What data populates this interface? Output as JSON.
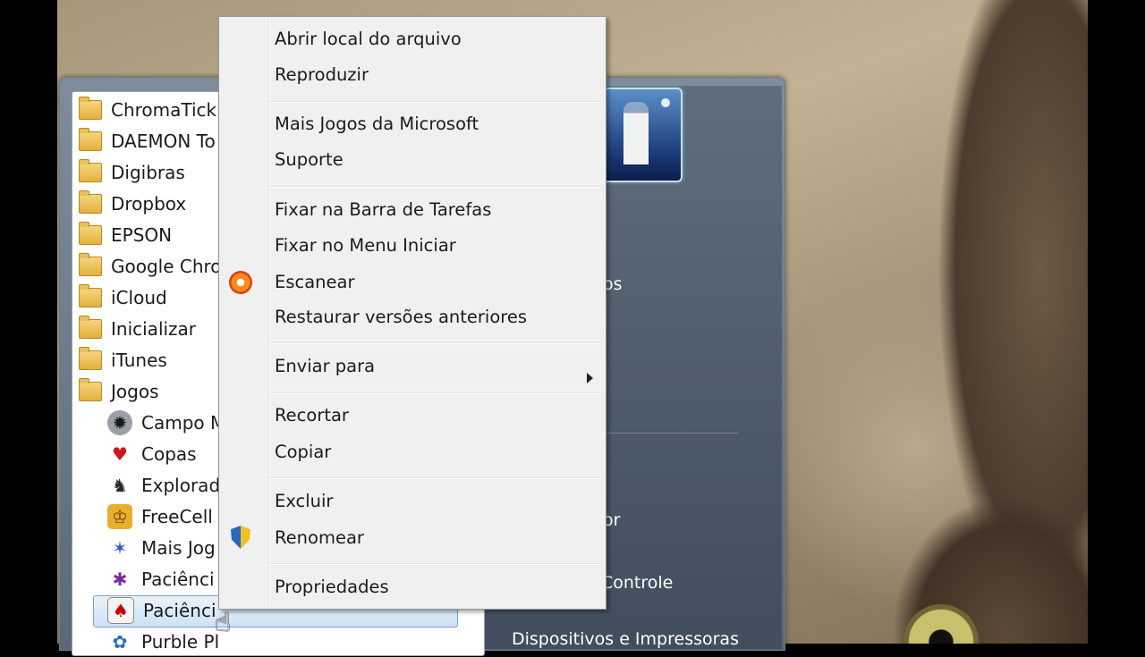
{
  "context_menu": {
    "items": [
      {
        "label": "Abrir local do arquivo"
      },
      {
        "label": "Reproduzir"
      },
      {
        "label": "Mais Jogos da Microsoft"
      },
      {
        "label": "Suporte"
      },
      {
        "label": "Fixar na Barra de Tarefas"
      },
      {
        "label": "Fixar no Menu Iniciar"
      },
      {
        "label": "Escanear",
        "icon": "scan-icon"
      },
      {
        "label": "Restaurar versões anteriores"
      },
      {
        "label": "Enviar para",
        "icon": "submenu-arrow-icon"
      },
      {
        "label": "Recortar"
      },
      {
        "label": "Copiar"
      },
      {
        "label": "Excluir"
      },
      {
        "label": "Renomear",
        "icon": "shield-icon"
      },
      {
        "label": "Propriedades"
      }
    ]
  },
  "programs": {
    "folders": [
      {
        "label": "ChromaTick"
      },
      {
        "label": "DAEMON To"
      },
      {
        "label": "Digibras"
      },
      {
        "label": "Dropbox"
      },
      {
        "label": "EPSON"
      },
      {
        "label": "Google Chro"
      },
      {
        "label": "iCloud"
      },
      {
        "label": "Inicializar"
      },
      {
        "label": "iTunes"
      },
      {
        "label": "Jogos"
      }
    ],
    "games": [
      {
        "label": "Campo M",
        "icon": "minesweeper-icon"
      },
      {
        "label": "Copas",
        "icon": "hearts-icon"
      },
      {
        "label": "Explorad",
        "icon": "chess-icon"
      },
      {
        "label": "FreeCell",
        "icon": "freecell-icon"
      },
      {
        "label": "Mais Jog",
        "icon": "more-games-icon"
      },
      {
        "label": "Paciênci",
        "icon": "spider-solitaire-icon"
      },
      {
        "label": "Paciênci",
        "icon": "solitaire-icon",
        "selected": true
      },
      {
        "label": "Purble Pl",
        "icon": "purble-place-icon"
      }
    ]
  },
  "right_pane": {
    "items": [
      {
        "label": "os"
      },
      {
        "label": "or"
      },
      {
        "label": "Controle"
      },
      {
        "label": "Dispositivos e Impressoras"
      }
    ]
  }
}
